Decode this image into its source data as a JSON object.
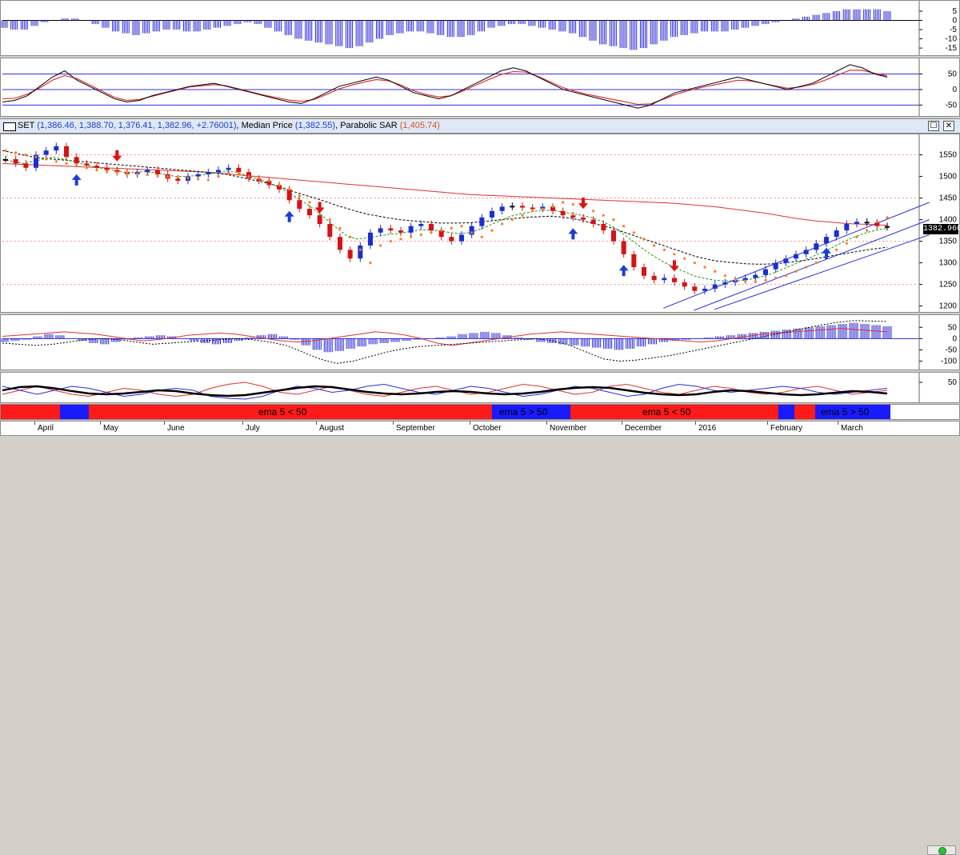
{
  "header": {
    "symbol": "SET",
    "ohlc": "(1,386.46, 1,388.70, 1,376.41, 1,382.96, +2.76001)",
    "median_label": "Median Price",
    "median_value": "(1,382.55)",
    "sar_label": "Parabolic SAR",
    "sar_value": "(1,405.74)",
    "restore_glyph": "☐",
    "close_glyph": "✕"
  },
  "last_price_tag": "1382.960",
  "ema_strip": {
    "segments": [
      {
        "color": "#ff1a1a",
        "label": ""
      },
      {
        "color": "#1a1aff",
        "label": ""
      },
      {
        "color": "#ff1a1a",
        "label": "ema 5 < 50"
      },
      {
        "color": "#1a1aff",
        "label": "ema 5 > 50"
      },
      {
        "color": "#ff1a1a",
        "label": "ema 5 < 50"
      },
      {
        "color": "#1a1aff",
        "label": ""
      },
      {
        "color": "#ff1a1a",
        "label": ""
      },
      {
        "color": "#1a1aff",
        "label": "ema 5 > 50"
      }
    ]
  },
  "months": [
    "April",
    "May",
    "June",
    "July",
    "August",
    "September",
    "October",
    "November",
    "December",
    "2016",
    "February",
    "March"
  ],
  "colors": {
    "up_candle": "#1a2fd0",
    "down_candle": "#d41414",
    "neutral_candle": "#000000",
    "sar": "#ff7a1a",
    "ma_red": "#e03030",
    "ma_black_dashed": "#000000",
    "ma_green_dashed": "#1a9a1a",
    "channel": "#2a2ae0",
    "buy_arrow": "#1a3fd8",
    "sell_arrow": "#e01010"
  },
  "chart_data": [
    {
      "type": "histogram",
      "yticks": [
        5,
        0,
        -5,
        -10,
        -15
      ],
      "ylim": [
        -18,
        8
      ],
      "values": [
        -4,
        -5,
        -5,
        -3,
        -1,
        0,
        1,
        1,
        0,
        -2,
        -4,
        -6,
        -7,
        -8,
        -7,
        -6,
        -5,
        -5,
        -6,
        -6,
        -5,
        -4,
        -3,
        -2,
        -1,
        -2,
        -4,
        -6,
        -8,
        -10,
        -11,
        -12,
        -13,
        -14,
        -15,
        -14,
        -12,
        -10,
        -8,
        -7,
        -6,
        -6,
        -7,
        -8,
        -9,
        -9,
        -8,
        -6,
        -4,
        -3,
        -2,
        -2,
        -3,
        -4,
        -5,
        -6,
        -7,
        -9,
        -11,
        -13,
        -14,
        -15,
        -16,
        -15,
        -13,
        -11,
        -9,
        -8,
        -7,
        -6,
        -6,
        -6,
        -5,
        -4,
        -3,
        -2,
        -1,
        0,
        1,
        2,
        3,
        4,
        5,
        6,
        6,
        6,
        6,
        5
      ]
    },
    {
      "type": "line",
      "yticks": [
        50,
        0,
        -50
      ],
      "ylim": [
        -80,
        90
      ],
      "hlines": [
        50,
        0,
        -50
      ],
      "series_a": [
        -40,
        -35,
        -20,
        10,
        40,
        60,
        30,
        10,
        -10,
        -30,
        -40,
        -35,
        -20,
        -10,
        0,
        10,
        15,
        20,
        10,
        0,
        -10,
        -20,
        -30,
        -40,
        -45,
        -30,
        -10,
        10,
        20,
        30,
        40,
        30,
        10,
        -10,
        -20,
        -30,
        -20,
        0,
        20,
        40,
        60,
        70,
        60,
        40,
        20,
        0,
        -10,
        -20,
        -30,
        -40,
        -50,
        -60,
        -50,
        -30,
        -10,
        0,
        10,
        20,
        30,
        40,
        30,
        20,
        10,
        0,
        10,
        20,
        40,
        60,
        80,
        70,
        50,
        40
      ],
      "series_b": [
        -30,
        -28,
        -15,
        5,
        30,
        45,
        35,
        15,
        -5,
        -25,
        -35,
        -32,
        -22,
        -12,
        -2,
        8,
        12,
        16,
        12,
        2,
        -8,
        -18,
        -26,
        -34,
        -38,
        -32,
        -16,
        2,
        14,
        24,
        32,
        28,
        14,
        -4,
        -16,
        -24,
        -20,
        -4,
        14,
        32,
        48,
        58,
        56,
        42,
        24,
        6,
        -6,
        -16,
        -24,
        -32,
        -40,
        -48,
        -46,
        -32,
        -16,
        -4,
        6,
        14,
        22,
        30,
        28,
        20,
        12,
        4,
        8,
        16,
        30,
        46,
        62,
        62,
        52,
        44
      ]
    },
    {
      "type": "candlestick",
      "yticks": [
        1550,
        1500,
        1450,
        1400,
        1350,
        1300,
        1250,
        1200
      ],
      "ylim": [
        1190,
        1590
      ],
      "last": 1382.96,
      "close": [
        1540,
        1530,
        1520,
        1550,
        1560,
        1570,
        1545,
        1530,
        1525,
        1520,
        1515,
        1510,
        1505,
        1510,
        1515,
        1505,
        1495,
        1490,
        1500,
        1505,
        1510,
        1515,
        1520,
        1510,
        1495,
        1490,
        1480,
        1470,
        1445,
        1425,
        1410,
        1390,
        1360,
        1330,
        1310,
        1340,
        1370,
        1380,
        1375,
        1370,
        1385,
        1390,
        1375,
        1360,
        1350,
        1365,
        1385,
        1405,
        1420,
        1430,
        1432,
        1428,
        1425,
        1430,
        1420,
        1410,
        1405,
        1400,
        1390,
        1375,
        1350,
        1320,
        1290,
        1270,
        1260,
        1265,
        1255,
        1245,
        1235,
        1240,
        1250,
        1255,
        1260,
        1265,
        1272,
        1285,
        1300,
        1310,
        1320,
        1330,
        1345,
        1360,
        1375,
        1390,
        1395,
        1393,
        1385,
        1383
      ],
      "sar": [
        1560,
        1555,
        1550,
        1545,
        1540,
        1535,
        1530,
        1525,
        1520,
        1515,
        1512,
        1510,
        1508,
        1506,
        1504,
        1502,
        1500,
        1498,
        1496,
        1494,
        1492,
        1500,
        1508,
        1505,
        1500,
        1495,
        1490,
        1480,
        1470,
        1455,
        1440,
        1420,
        1400,
        1380,
        1360,
        1330,
        1300,
        1340,
        1350,
        1355,
        1360,
        1365,
        1370,
        1375,
        1380,
        1385,
        1370,
        1360,
        1375,
        1390,
        1400,
        1410,
        1420,
        1425,
        1430,
        1440,
        1435,
        1430,
        1420,
        1410,
        1400,
        1385,
        1370,
        1355,
        1340,
        1330,
        1320,
        1310,
        1300,
        1290,
        1280,
        1270,
        1260,
        1258,
        1256,
        1260,
        1265,
        1270,
        1280,
        1290,
        1300,
        1315,
        1330,
        1345,
        1360,
        1375,
        1395,
        1405
      ],
      "ma_red": [
        1530,
        1529,
        1528,
        1527,
        1526,
        1525,
        1524,
        1523,
        1522,
        1521,
        1520,
        1519,
        1518,
        1517,
        1516,
        1515,
        1514,
        1513,
        1512,
        1511,
        1510,
        1508,
        1506,
        1504,
        1502,
        1500,
        1498,
        1496,
        1494,
        1492,
        1490,
        1488,
        1486,
        1484,
        1482,
        1480,
        1478,
        1476,
        1474,
        1472,
        1470,
        1468,
        1466,
        1464,
        1462,
        1460,
        1458,
        1457,
        1456,
        1455,
        1454,
        1453,
        1452,
        1451,
        1450,
        1449,
        1448,
        1447,
        1446,
        1445,
        1444,
        1443,
        1442,
        1441,
        1440,
        1439,
        1438,
        1436,
        1434,
        1432,
        1430,
        1427,
        1424,
        1421,
        1418,
        1415,
        1411,
        1407,
        1403,
        1400,
        1397,
        1395,
        1393,
        1391,
        1390,
        1389,
        1388,
        1387
      ],
      "ma_black": [
        1560,
        1555,
        1550,
        1545,
        1542,
        1540,
        1538,
        1536,
        1534,
        1532,
        1530,
        1528,
        1526,
        1524,
        1522,
        1520,
        1518,
        1516,
        1514,
        1512,
        1510,
        1508,
        1505,
        1500,
        1495,
        1490,
        1485,
        1478,
        1470,
        1462,
        1455,
        1448,
        1440,
        1432,
        1425,
        1418,
        1412,
        1408,
        1404,
        1400,
        1398,
        1396,
        1394,
        1392,
        1392,
        1392,
        1393,
        1395,
        1397,
        1400,
        1402,
        1404,
        1406,
        1407,
        1408,
        1406,
        1403,
        1398,
        1392,
        1386,
        1380,
        1372,
        1364,
        1356,
        1348,
        1340,
        1332,
        1324,
        1316,
        1310,
        1305,
        1302,
        1300,
        1298,
        1297,
        1297,
        1298,
        1300,
        1303,
        1306,
        1310,
        1314,
        1318,
        1322,
        1326,
        1330,
        1333,
        1336
      ],
      "ma_green": [
        1540,
        1535,
        1530,
        1535,
        1540,
        1545,
        1540,
        1535,
        1528,
        1522,
        1518,
        1514,
        1510,
        1510,
        1511,
        1509,
        1505,
        1500,
        1500,
        1502,
        1505,
        1508,
        1512,
        1510,
        1502,
        1495,
        1487,
        1478,
        1465,
        1450,
        1435,
        1418,
        1398,
        1378,
        1360,
        1355,
        1358,
        1362,
        1366,
        1368,
        1372,
        1376,
        1376,
        1374,
        1370,
        1368,
        1370,
        1378,
        1388,
        1398,
        1408,
        1414,
        1418,
        1422,
        1422,
        1418,
        1414,
        1410,
        1404,
        1396,
        1384,
        1368,
        1350,
        1332,
        1316,
        1302,
        1290,
        1280,
        1270,
        1264,
        1260,
        1258,
        1258,
        1260,
        1264,
        1270,
        1278,
        1288,
        1298,
        1308,
        1318,
        1328,
        1340,
        1352,
        1362,
        1370,
        1376,
        1380
      ],
      "buy_idx": [
        7,
        28,
        56,
        61,
        81
      ],
      "sell_idx": [
        11,
        31,
        57,
        66
      ],
      "channel_lines": [
        {
          "from": [
            65,
            1195
          ],
          "to": [
            88,
            1440
          ]
        },
        {
          "from": [
            68,
            1190
          ],
          "to": [
            88,
            1400
          ]
        },
        {
          "from": [
            70,
            1192
          ],
          "to": [
            88,
            1365
          ]
        }
      ]
    },
    {
      "type": "histogram",
      "yticks": [
        50,
        0,
        -50,
        -100
      ],
      "ylim": [
        -130,
        90
      ],
      "values": [
        -15,
        -10,
        -5,
        10,
        20,
        15,
        0,
        -10,
        -20,
        -25,
        -15,
        -5,
        5,
        10,
        15,
        10,
        0,
        -10,
        -20,
        -25,
        -20,
        -10,
        5,
        15,
        20,
        10,
        -5,
        -30,
        -50,
        -60,
        -55,
        -45,
        -35,
        -25,
        -20,
        -15,
        -10,
        -5,
        0,
        5,
        10,
        20,
        25,
        30,
        25,
        15,
        5,
        -5,
        -15,
        -20,
        -25,
        -30,
        -35,
        -40,
        -45,
        -50,
        -45,
        -35,
        -25,
        -15,
        -10,
        -5,
        0,
        5,
        10,
        15,
        20,
        25,
        30,
        35,
        40,
        45,
        50,
        55,
        60,
        65,
        70,
        65,
        60,
        55
      ],
      "line_red": [
        10,
        15,
        20,
        25,
        30,
        25,
        20,
        10,
        0,
        -10,
        -5,
        5,
        15,
        20,
        25,
        20,
        10,
        0,
        -10,
        -15,
        -10,
        0,
        10,
        20,
        30,
        25,
        15,
        0,
        -20,
        -30,
        -20,
        -10,
        0,
        10,
        20,
        25,
        30,
        25,
        20,
        15,
        10,
        5,
        0,
        -5,
        -10,
        -15,
        -10,
        0,
        10,
        20,
        25,
        30,
        35,
        40,
        45,
        40,
        35,
        30
      ],
      "line_black": [
        -20,
        -25,
        -30,
        -25,
        -15,
        -5,
        0,
        -5,
        -15,
        -25,
        -20,
        -15,
        -10,
        -5,
        0,
        -5,
        -15,
        -30,
        -60,
        -90,
        -110,
        -100,
        -80,
        -60,
        -45,
        -35,
        -30,
        -25,
        -20,
        -15,
        -10,
        -5,
        0,
        -10,
        -30,
        -60,
        -90,
        -100,
        -95,
        -85,
        -75,
        -60,
        -45,
        -30,
        -15,
        0,
        15,
        30,
        45,
        60,
        72,
        80,
        78,
        76
      ]
    },
    {
      "type": "line",
      "yticks": [
        50
      ],
      "ylim": [
        0,
        70
      ],
      "black": [
        30,
        38,
        40,
        35,
        28,
        22,
        20,
        22,
        26,
        30,
        28,
        22,
        18,
        16,
        18,
        24,
        30,
        36,
        40,
        38,
        32,
        26,
        22,
        20,
        22,
        26,
        28,
        26,
        22,
        20,
        22,
        26,
        32,
        36,
        38,
        36,
        30,
        24,
        20,
        18,
        20,
        26,
        30,
        28,
        24,
        20,
        18,
        20,
        24,
        28,
        26,
        22
      ],
      "red": [
        20,
        30,
        40,
        30,
        20,
        15,
        25,
        35,
        30,
        20,
        15,
        20,
        35,
        45,
        50,
        40,
        25,
        20,
        30,
        40,
        30,
        20,
        15,
        25,
        35,
        40,
        30,
        20,
        25,
        35,
        45,
        40,
        30,
        20,
        25,
        40,
        45,
        35,
        25,
        20,
        30,
        40,
        35,
        25,
        20,
        25,
        35,
        40,
        30,
        20,
        25,
        30
      ],
      "blue": [
        40,
        30,
        20,
        30,
        40,
        35,
        25,
        15,
        20,
        30,
        35,
        30,
        15,
        10,
        8,
        15,
        30,
        40,
        35,
        25,
        30,
        40,
        45,
        35,
        25,
        20,
        30,
        40,
        35,
        25,
        15,
        20,
        30,
        40,
        35,
        25,
        15,
        20,
        35,
        45,
        40,
        30,
        25,
        30,
        35,
        40,
        35,
        25,
        20,
        25,
        30,
        35
      ]
    }
  ]
}
